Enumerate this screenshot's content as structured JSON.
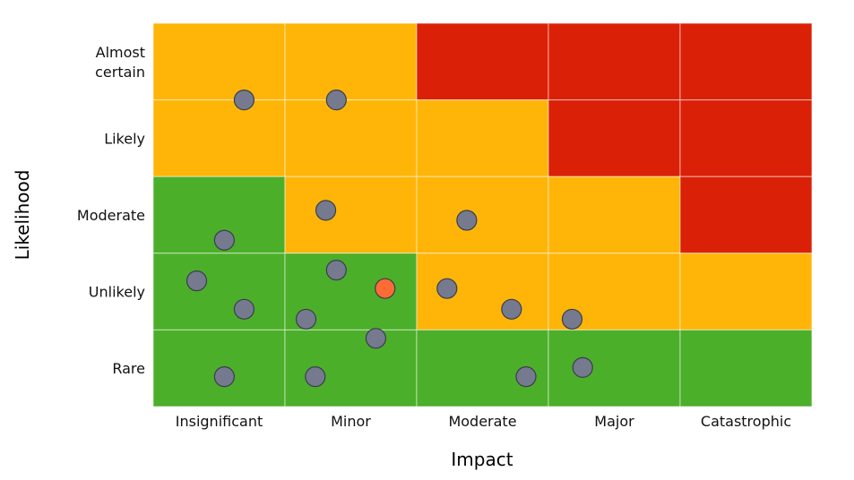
{
  "chart_data": {
    "type": "heatmap",
    "title": "",
    "xlabel": "Impact",
    "ylabel": "Likelihood",
    "x_categories": [
      "Insignificant",
      "Minor",
      "Moderate",
      "Major",
      "Catastrophic"
    ],
    "y_categories_top_to_bottom": [
      "Almost certain",
      "Likely",
      "Moderate",
      "Unlikely",
      "Rare"
    ],
    "y_category_lines": {
      "Almost certain": [
        "Almost",
        "certain"
      ]
    },
    "level_colors": {
      "low": "#4caf2a",
      "medium": "#ffb508",
      "high": "#da2108"
    },
    "matrix_levels_top_to_bottom": [
      [
        "medium",
        "medium",
        "high",
        "high",
        "high"
      ],
      [
        "medium",
        "medium",
        "medium",
        "high",
        "high"
      ],
      [
        "low",
        "medium",
        "medium",
        "medium",
        "high"
      ],
      [
        "low",
        "low",
        "medium",
        "medium",
        "medium"
      ],
      [
        "low",
        "low",
        "low",
        "low",
        "low"
      ]
    ],
    "point_colors": {
      "default": "#767a8f",
      "highlight": "#ff6b35"
    },
    "points_note": "impact and likelihood in continuous category units: impact 0-5 from left, likelihood 0-5 from bottom",
    "points": [
      {
        "impact": 0.69,
        "likelihood": 4.0,
        "kind": "default"
      },
      {
        "impact": 1.39,
        "likelihood": 4.0,
        "kind": "default"
      },
      {
        "impact": 1.31,
        "likelihood": 2.56,
        "kind": "default"
      },
      {
        "impact": 0.54,
        "likelihood": 2.17,
        "kind": "default"
      },
      {
        "impact": 2.38,
        "likelihood": 2.43,
        "kind": "default"
      },
      {
        "impact": 0.33,
        "likelihood": 1.64,
        "kind": "default"
      },
      {
        "impact": 0.69,
        "likelihood": 1.27,
        "kind": "default"
      },
      {
        "impact": 1.39,
        "likelihood": 1.78,
        "kind": "default"
      },
      {
        "impact": 1.76,
        "likelihood": 1.54,
        "kind": "highlight"
      },
      {
        "impact": 1.16,
        "likelihood": 1.14,
        "kind": "default"
      },
      {
        "impact": 1.69,
        "likelihood": 0.89,
        "kind": "default"
      },
      {
        "impact": 2.23,
        "likelihood": 1.54,
        "kind": "default"
      },
      {
        "impact": 2.72,
        "likelihood": 1.27,
        "kind": "default"
      },
      {
        "impact": 3.18,
        "likelihood": 1.14,
        "kind": "default"
      },
      {
        "impact": 0.54,
        "likelihood": 0.39,
        "kind": "default"
      },
      {
        "impact": 1.23,
        "likelihood": 0.39,
        "kind": "default"
      },
      {
        "impact": 2.83,
        "likelihood": 0.39,
        "kind": "default"
      },
      {
        "impact": 3.26,
        "likelihood": 0.51,
        "kind": "default"
      }
    ],
    "grid": true,
    "legend": "none"
  }
}
